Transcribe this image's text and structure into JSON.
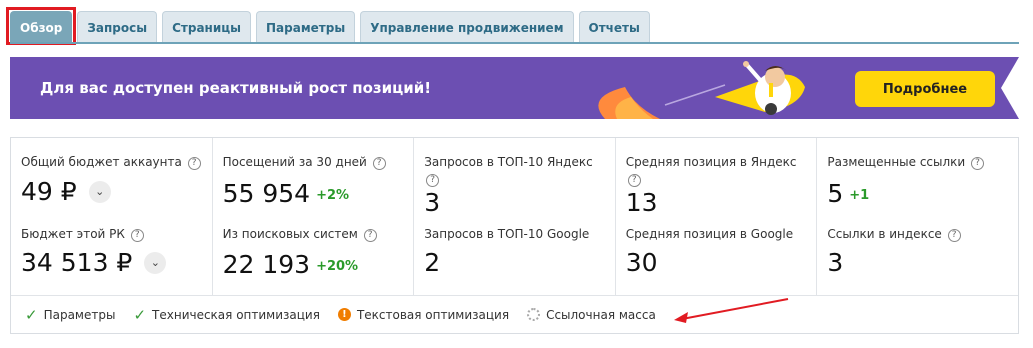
{
  "tabs": [
    {
      "label": "Обзор",
      "active": true
    },
    {
      "label": "Запросы"
    },
    {
      "label": "Страницы"
    },
    {
      "label": "Параметры"
    },
    {
      "label": "Управление продвижением"
    },
    {
      "label": "Отчеты"
    }
  ],
  "banner": {
    "text": "Для вас доступен реактивный рост позиций!",
    "cta": "Подробнее"
  },
  "stats": {
    "col1": {
      "label": "Общий бюджет аккаунта",
      "value": "49 ₽",
      "sub_label": "Бюджет этой РК",
      "sub_value": "34 513 ₽"
    },
    "col2": {
      "label": "Посещений за 30 дней",
      "value": "55 954",
      "delta": "+2%",
      "sub_label": "Из поисковых систем",
      "sub_value": "22 193",
      "sub_delta": "+20%"
    },
    "col3": {
      "label": "Запросов в ТОП-10 Яндекс",
      "value": "3",
      "sub_label": "Запросов в ТОП-10 Google",
      "sub_value": "2"
    },
    "col4": {
      "label": "Средняя позиция в Яндекс",
      "value": "13",
      "sub_label": "Средняя позиция в Google",
      "sub_value": "30"
    },
    "col5": {
      "label": "Размещенные ссылки",
      "value": "5",
      "delta": "+1",
      "sub_label": "Ссылки в индексе",
      "sub_value": "3"
    }
  },
  "status": [
    {
      "label": "Параметры",
      "state": "done"
    },
    {
      "label": "Техническая оптимизация",
      "state": "done"
    },
    {
      "label": "Текстовая оптимизация",
      "state": "warning"
    },
    {
      "label": "Ссылочная масса",
      "state": "loading"
    }
  ],
  "colors": {
    "accent": "#6c4fb2",
    "cta": "#ffd60a",
    "positive": "#2a9a2a",
    "highlight": "#e11b22"
  }
}
